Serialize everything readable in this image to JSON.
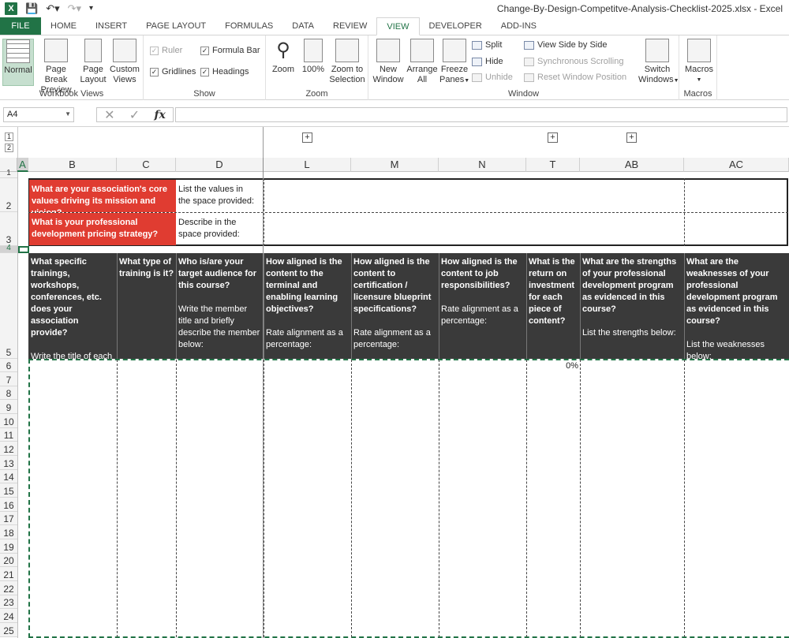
{
  "window": {
    "title": "Change-By-Design-Competitve-Analysis-Checklist-2025.xlsx - Excel"
  },
  "tabs": [
    "FILE",
    "HOME",
    "INSERT",
    "PAGE LAYOUT",
    "FORMULAS",
    "DATA",
    "REVIEW",
    "VIEW",
    "DEVELOPER",
    "ADD-INS"
  ],
  "active_tab": "VIEW",
  "ribbon": {
    "workbook_views": {
      "label": "Workbook Views",
      "normal": "Normal",
      "page_break_1": "Page Break",
      "page_break_2": "Preview",
      "page_layout_1": "Page",
      "page_layout_2": "Layout",
      "custom_views_1": "Custom",
      "custom_views_2": "Views"
    },
    "show": {
      "label": "Show",
      "ruler": "Ruler",
      "formula_bar": "Formula Bar",
      "gridlines": "Gridlines",
      "headings": "Headings"
    },
    "zoom": {
      "label": "Zoom",
      "zoom": "Zoom",
      "hundred": "100%",
      "zoom_sel_1": "Zoom to",
      "zoom_sel_2": "Selection"
    },
    "window": {
      "label": "Window",
      "new_window_1": "New",
      "new_window_2": "Window",
      "arrange_1": "Arrange",
      "arrange_2": "All",
      "freeze_1": "Freeze",
      "freeze_2": "Panes",
      "split": "Split",
      "hide": "Hide",
      "unhide": "Unhide",
      "side_by_side": "View Side by Side",
      "sync_scroll": "Synchronous Scrolling",
      "reset_pos": "Reset Window Position",
      "switch_1": "Switch",
      "switch_2": "Windows"
    },
    "macros": {
      "label": "Macros",
      "macros": "Macros"
    }
  },
  "formula_bar": {
    "name_box": "A4",
    "formula": ""
  },
  "outline_levels": [
    "1",
    "2"
  ],
  "columns": [
    "A",
    "B",
    "C",
    "D",
    "L",
    "M",
    "N",
    "T",
    "AB",
    "AC"
  ],
  "rows": [
    "1",
    "2",
    "3",
    "4",
    "5",
    "6",
    "7",
    "8",
    "9",
    "10",
    "11",
    "12",
    "13",
    "14",
    "15",
    "16",
    "17",
    "18",
    "19",
    "20",
    "21",
    "22",
    "23",
    "24",
    "25"
  ],
  "sheet": {
    "row2_question": "What are your association's core values driving its mission and vision?",
    "row2_instruction_1": "List the values in",
    "row2_instruction_2": "the space provided:",
    "row3_question": "What is your professional development pricing strategy?",
    "row3_instruction_1": "Describe in the",
    "row3_instruction_2": "space provided:",
    "headers": {
      "B_q": "What specific trainings, workshops, conferences, etc. does your association provide?",
      "B_note": "Write the title of each training below:",
      "C_q": "What type of training is it?",
      "D_q": "Who is/are your target audience for this course?",
      "D_note": "Write the member title and briefly describe the member below:",
      "L_q": "How aligned is the content to the terminal and enabling learning objectives?",
      "L_note": "Rate  alignment as a percentage:",
      "M_q": "How aligned is the content to certification / licensure blueprint specifications?",
      "M_note": "Rate  alignment as a percentage:",
      "N_q": "How aligned is the content to job responsibilities?",
      "N_note": "Rate  alignment as a percentage:",
      "T_q": "What is the return on investment for each piece of content?",
      "AB_q": "What are the strengths of your professional development program as evidenced in this course?",
      "AB_note": "List the strengths below:",
      "AC_q": "What are the weaknesses of your professional development program as evidenced in this course?",
      "AC_note": "List the weaknesses below:"
    },
    "T6_value": "0%"
  }
}
